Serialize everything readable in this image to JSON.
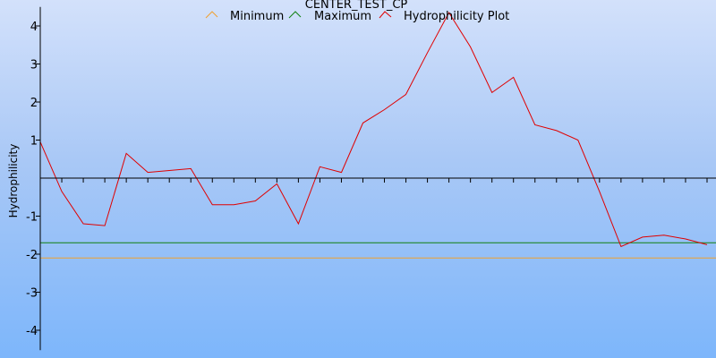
{
  "chart_data": {
    "type": "line",
    "title": "CENTER_TEST_CP",
    "ylabel": "Hydrophilicity",
    "xlabel": "",
    "ylim": [
      -4.5,
      4.5
    ],
    "yticks": [
      -4,
      -3,
      -2,
      -1,
      1,
      2,
      3,
      4
    ],
    "ytick_labels": [
      "-4",
      "-3",
      "-2",
      "-1",
      "1",
      "2",
      "3",
      "4"
    ],
    "x_count": 32,
    "legend": [
      {
        "name": "Minimum",
        "color": "#f0a030"
      },
      {
        "name": "Maximum",
        "color": "#108010"
      },
      {
        "name": "Hydrophilicity Plot",
        "color": "#e00000"
      }
    ],
    "series": [
      {
        "name": "Minimum",
        "color": "#f0a030",
        "constant": -2.1
      },
      {
        "name": "Maximum",
        "color": "#108010",
        "constant": -1.7
      },
      {
        "name": "Hydrophilicity Plot",
        "color": "#e00000",
        "values": [
          0.95,
          -0.35,
          -1.2,
          -1.25,
          0.65,
          0.15,
          0.2,
          0.25,
          -0.7,
          -0.7,
          -0.6,
          -0.15,
          -1.2,
          0.3,
          0.15,
          1.45,
          1.8,
          2.2,
          3.3,
          4.35,
          3.45,
          2.25,
          2.65,
          1.4,
          1.25,
          1.0,
          -0.35,
          -1.8,
          -1.55,
          -1.5,
          -1.6,
          -1.75
        ]
      }
    ]
  }
}
